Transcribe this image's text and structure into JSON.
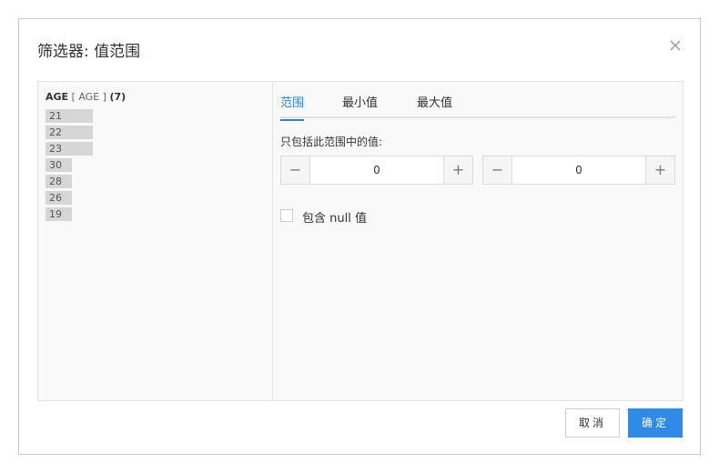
{
  "dialog": {
    "title": "筛选器: 值范围",
    "close_icon": "close-icon"
  },
  "field": {
    "name": "AGE",
    "alias": "[ AGE ]",
    "count": "(7)"
  },
  "values": [
    {
      "label": "21",
      "share": 1.0
    },
    {
      "label": "22",
      "share": 1.0
    },
    {
      "label": "23",
      "share": 1.0
    },
    {
      "label": "30",
      "share": 0.55
    },
    {
      "label": "28",
      "share": 0.55
    },
    {
      "label": "26",
      "share": 0.55
    },
    {
      "label": "19",
      "share": 0.55
    }
  ],
  "tabs": [
    {
      "label": "范围",
      "active": true
    },
    {
      "label": "最小值",
      "active": false
    },
    {
      "label": "最大值",
      "active": false
    }
  ],
  "range": {
    "label": "只包括此范围中的值:",
    "min_value": "0",
    "max_value": "0",
    "minus": "−",
    "plus": "+"
  },
  "include_null": {
    "label": "包含 null 值",
    "checked": false
  },
  "buttons": {
    "cancel": "取消",
    "ok": "确定"
  },
  "colors": {
    "accent": "#2f86d8",
    "primary_button": "#2f8ae8",
    "bar": "#d6d6d6"
  }
}
